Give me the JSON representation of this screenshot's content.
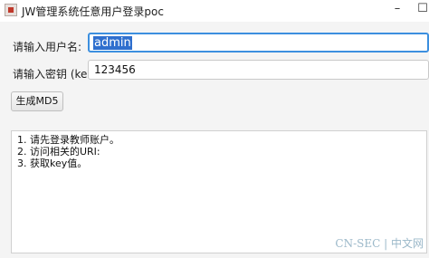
{
  "window": {
    "title": "JW管理系统任意用户登录poc",
    "minimize_glyph": "–",
    "maximize_glyph": "☐",
    "app_icon": "java-app-icon"
  },
  "form": {
    "username_label": "请输入用户名:",
    "username_value": "admin",
    "key_label": "请输入密钥 (ke...",
    "key_value": "123456",
    "generate_button_label": "生成MD5"
  },
  "output": {
    "lines": [
      "1. 请先登录教师账户。",
      "2. 访问相关的URI:",
      "3. 获取key值。"
    ]
  },
  "watermark": {
    "text": "CN-SEC | 中文网"
  },
  "colors": {
    "focus_border": "#3c8fdf",
    "selection": "#2f6fce",
    "content_bg": "#f4f4f4"
  }
}
